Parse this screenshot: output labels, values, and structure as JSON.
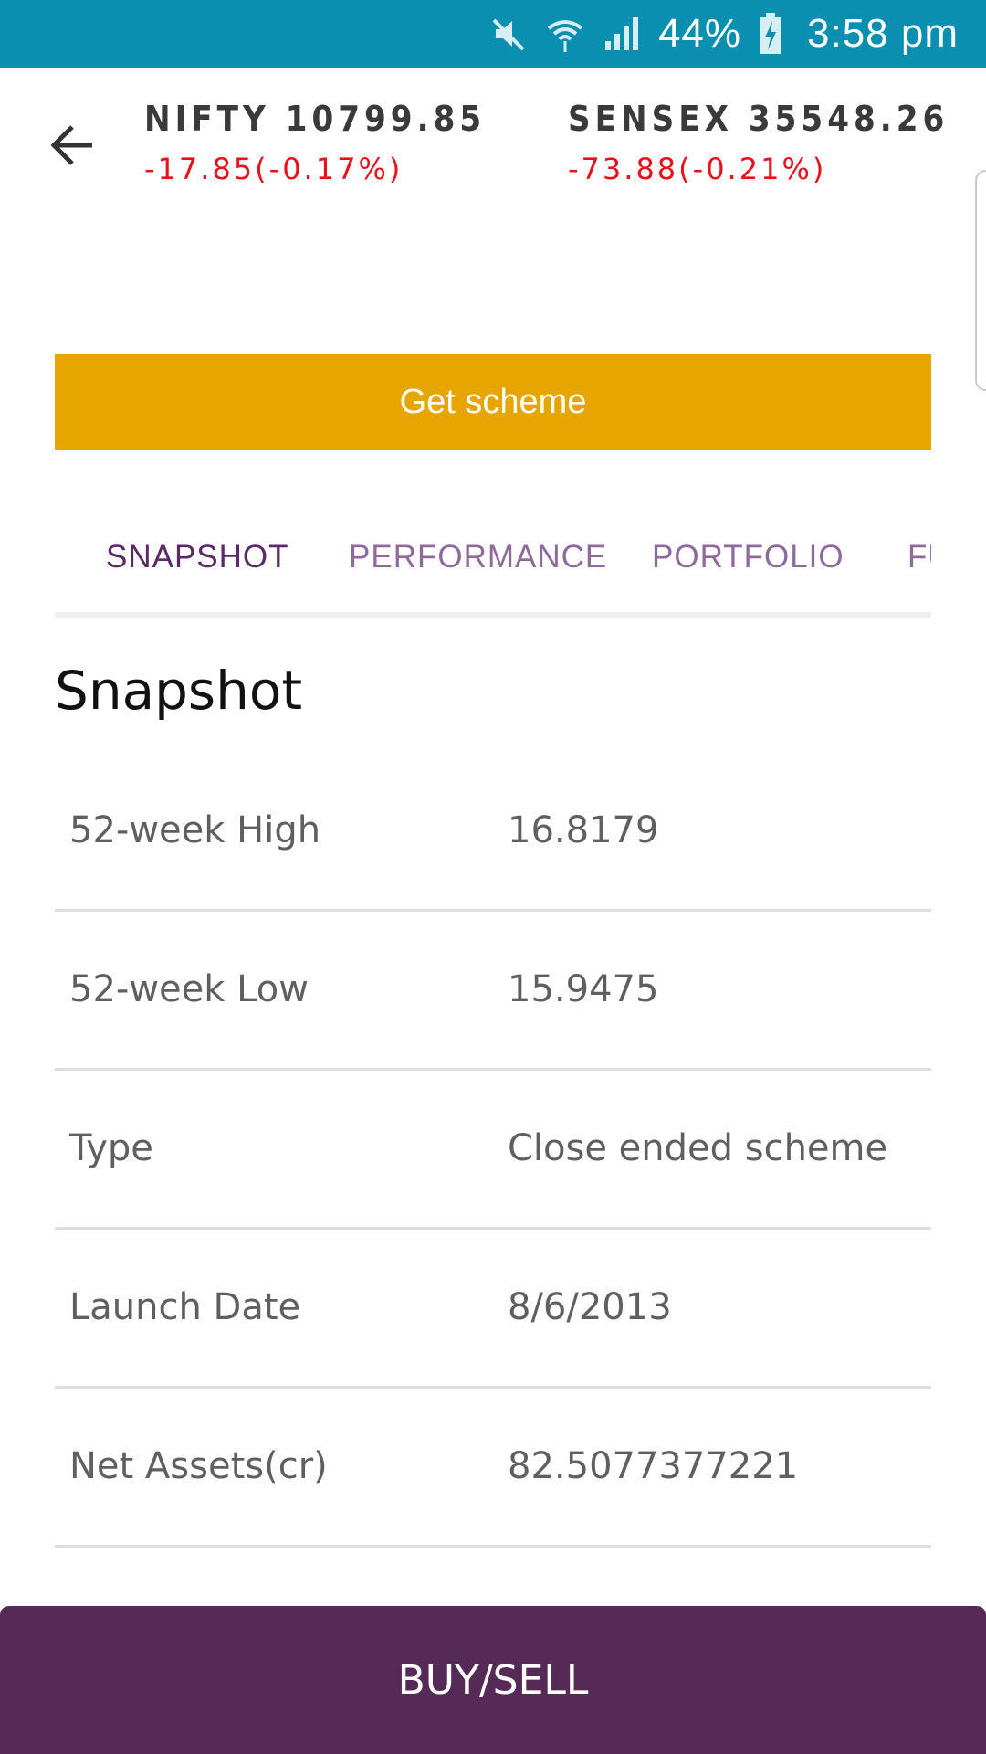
{
  "status_bar": {
    "icons": [
      "mute-icon",
      "wifi-icon",
      "signal-icon",
      "battery-charging-icon"
    ],
    "battery_percent": "44%",
    "time": "3:58 pm"
  },
  "header": {
    "back_icon": "arrow-left-icon",
    "tickers": [
      {
        "name": "NIFTY 10799.85",
        "change": "-17.85(-0.17%)"
      },
      {
        "name": "SENSEX 35548.26",
        "change": "-73.88(-0.21%)"
      }
    ]
  },
  "actions": {
    "get_scheme_label": "Get scheme",
    "buy_sell_label": "BUY/SELL"
  },
  "tabs": [
    {
      "label": "SNAPSHOT",
      "active": true
    },
    {
      "label": "PERFORMANCE",
      "active": false
    },
    {
      "label": "PORTFOLIO",
      "active": false
    },
    {
      "label": "FU",
      "active": false
    }
  ],
  "snapshot": {
    "title": "Snapshot",
    "rows": [
      {
        "label": "52-week High",
        "value": "16.8179"
      },
      {
        "label": "52-week Low",
        "value": "15.9475"
      },
      {
        "label": "Type",
        "value": "Close ended scheme"
      },
      {
        "label": "Launch Date",
        "value": "8/6/2013"
      },
      {
        "label": "Net Assets(cr)",
        "value": "82.5077377221"
      }
    ]
  },
  "colors": {
    "status_bar": "#0a8fb0",
    "accent_gold": "#e6a500",
    "brand_purple": "#552a56",
    "tab_text": "#8e6a9b",
    "negative_change": "#e8111b"
  }
}
